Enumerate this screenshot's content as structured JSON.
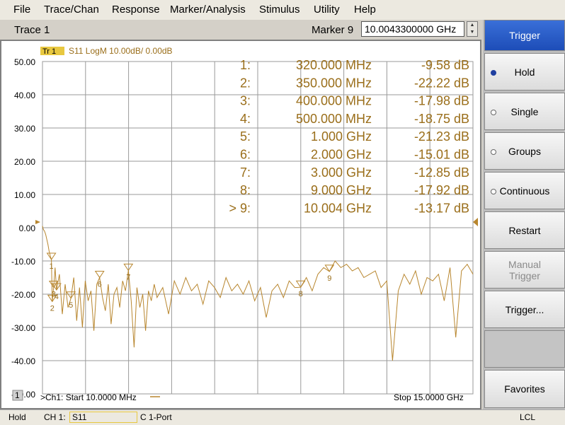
{
  "menu": {
    "items": [
      "File",
      "Trace/Chan",
      "Response",
      "Marker/Analysis",
      "Stimulus",
      "Utility",
      "Help"
    ]
  },
  "toolbar": {
    "trace_label": "Trace 1",
    "marker_label": "Marker 9",
    "marker_value": "10.0043300000 GHz"
  },
  "chart": {
    "trace_tag": "Tr 1",
    "trace_info": "S11 LogM 10.00dB/  0.00dB",
    "channel_label": "1",
    "start_label": ">Ch1: Start  10.0000 MHz",
    "stop_label": "Stop  15.0000 GHz",
    "colors": {
      "trace": "#b8862e",
      "marker_text": "#9a6e1a",
      "grid": "#9a9a9a",
      "ref_marker": "#b8862e"
    }
  },
  "marker_table": [
    {
      "id": "1:",
      "freq": "320.000 MHz",
      "value": "-9.58 dB"
    },
    {
      "id": "2:",
      "freq": "350.000 MHz",
      "value": "-22.22 dB"
    },
    {
      "id": "3:",
      "freq": "400.000 MHz",
      "value": "-17.98 dB"
    },
    {
      "id": "4:",
      "freq": "500.000 MHz",
      "value": "-18.75 dB"
    },
    {
      "id": "5:",
      "freq": "1.000 GHz",
      "value": "-21.23 dB"
    },
    {
      "id": "6:",
      "freq": "2.000 GHz",
      "value": "-15.01 dB"
    },
    {
      "id": "7:",
      "freq": "3.000 GHz",
      "value": "-12.85 dB"
    },
    {
      "id": "8:",
      "freq": "9.000 GHz",
      "value": "-17.92 dB"
    },
    {
      "id": "> 9:",
      "freq": "10.004 GHz",
      "value": "-13.17 dB"
    }
  ],
  "chart_data": {
    "type": "line",
    "series": [
      {
        "x_ghz": [
          0.01,
          0.04,
          0.08,
          0.12,
          0.16,
          0.2,
          0.24,
          0.28,
          0.32,
          0.35,
          0.4,
          0.45,
          0.5,
          0.6,
          0.7,
          0.8,
          0.9,
          1.0,
          1.1,
          1.2,
          1.3,
          1.4,
          1.5,
          1.6,
          1.7,
          1.8,
          1.9,
          2.0,
          2.1,
          2.2,
          2.3,
          2.4,
          2.5,
          2.6,
          2.7,
          2.8,
          2.9,
          3.0,
          3.1,
          3.2,
          3.3,
          3.4,
          3.5,
          3.6,
          3.7,
          3.8,
          3.9,
          4.0,
          4.2,
          4.4,
          4.6,
          4.8,
          5.0,
          5.2,
          5.4,
          5.6,
          5.8,
          6.0,
          6.2,
          6.4,
          6.6,
          6.8,
          7.0,
          7.2,
          7.4,
          7.6,
          7.8,
          8.0,
          8.2,
          8.4,
          8.6,
          8.8,
          9.0,
          9.2,
          9.4,
          9.6,
          9.8,
          10.0,
          10.2,
          10.4,
          10.6,
          10.8,
          11.0,
          11.2,
          11.4,
          11.6,
          11.8,
          12.0,
          12.2,
          12.4,
          12.6,
          12.8,
          13.0,
          13.2,
          13.4,
          13.6,
          13.8,
          14.0,
          14.2,
          14.4,
          14.6,
          14.8,
          15.0
        ],
        "y_db": [
          0.5,
          -0.5,
          -1.0,
          -2.0,
          -3.5,
          -5.0,
          -7.0,
          -8.5,
          -9.58,
          -22.22,
          -17.98,
          -12.0,
          -18.75,
          -14.0,
          -26.0,
          -17.0,
          -24.0,
          -21.23,
          -15.0,
          -28.0,
          -18.0,
          -30.0,
          -16.0,
          -22.0,
          -19.0,
          -31.0,
          -17.0,
          -15.01,
          -21.0,
          -25.0,
          -17.0,
          -29.0,
          -20.0,
          -18.0,
          -24.0,
          -16.0,
          -19.0,
          -12.85,
          -22.0,
          -36.0,
          -18.0,
          -24.0,
          -20.0,
          -31.0,
          -19.0,
          -22.0,
          -17.0,
          -21.0,
          -18.0,
          -26.0,
          -16.0,
          -20.0,
          -15.0,
          -19.0,
          -17.0,
          -23.0,
          -16.0,
          -18.0,
          -21.0,
          -15.0,
          -19.0,
          -17.0,
          -20.0,
          -16.0,
          -22.0,
          -18.0,
          -27.0,
          -19.0,
          -17.0,
          -21.0,
          -16.0,
          -18.0,
          -17.92,
          -15.0,
          -19.0,
          -14.0,
          -12.0,
          -13.17,
          -10.0,
          -12.0,
          -11.0,
          -13.0,
          -12.0,
          -15.0,
          -14.0,
          -13.0,
          -18.0,
          -16.0,
          -40.0,
          -19.0,
          -14.0,
          -17.0,
          -13.0,
          -20.0,
          -15.0,
          -16.0,
          -14.0,
          -22.0,
          -12.0,
          -33.0,
          -13.0,
          -11.0,
          -14.0,
          -10.0,
          -9.0
        ]
      }
    ],
    "markers": [
      {
        "label": "1",
        "x_ghz": 0.32,
        "y_db": -9.58
      },
      {
        "label": "2",
        "x_ghz": 0.35,
        "y_db": -22.22
      },
      {
        "label": "3",
        "x_ghz": 0.4,
        "y_db": -17.98
      },
      {
        "label": "4",
        "x_ghz": 0.5,
        "y_db": -18.75
      },
      {
        "label": "5",
        "x_ghz": 1.0,
        "y_db": -21.23
      },
      {
        "label": "6",
        "x_ghz": 2.0,
        "y_db": -15.01
      },
      {
        "label": "7",
        "x_ghz": 3.0,
        "y_db": -12.85
      },
      {
        "label": "8",
        "x_ghz": 9.0,
        "y_db": -17.92
      },
      {
        "label": "9",
        "x_ghz": 10.004,
        "y_db": -13.17
      }
    ],
    "xlim": [
      0.01,
      15.0
    ],
    "ylim": [
      -50,
      50
    ],
    "y_ticks": [
      "50.00",
      "40.00",
      "30.00",
      "20.00",
      "10.00",
      "0.00",
      "-10.00",
      "-20.00",
      "-30.00",
      "-40.00",
      "-50.00"
    ],
    "grid": true,
    "reference_db": 0
  },
  "softkeys": {
    "title": "Trigger",
    "hold": "Hold",
    "single": "Single",
    "groups": "Groups",
    "continuous": "Continuous",
    "restart": "Restart",
    "manual_line1": "Manual",
    "manual_line2": "Trigger",
    "trigger_more": "Trigger...",
    "favorites": "Favorites"
  },
  "status": {
    "hold": "Hold",
    "ch": "CH 1:",
    "param": "S11",
    "c_port": "C  1-Port",
    "lcl": "LCL"
  }
}
